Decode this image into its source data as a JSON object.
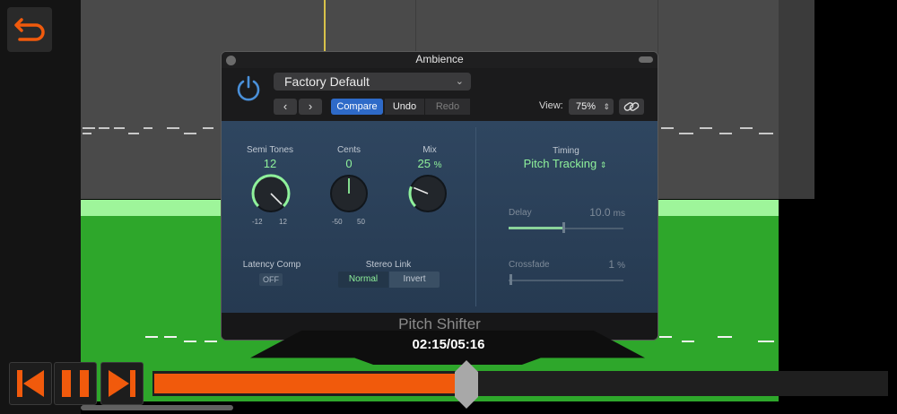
{
  "plugin": {
    "window_title": "Ambience",
    "preset": "Factory Default",
    "nav_prev": "‹",
    "nav_next": "›",
    "compare_label": "Compare",
    "undo_label": "Undo",
    "redo_label": "Redo",
    "view_label": "View:",
    "view_value": "75%",
    "plugin_name": "Pitch Shifter",
    "semi_tones": {
      "label": "Semi Tones",
      "value": "12",
      "min": "-12",
      "max": "12",
      "level": 1.0
    },
    "cents": {
      "label": "Cents",
      "value": "0",
      "min": "-50",
      "max": "50",
      "level": 0.5
    },
    "mix": {
      "label": "Mix",
      "value": "25",
      "unit": "%",
      "level": 0.25
    },
    "latency_comp": {
      "label": "Latency Comp",
      "value": "OFF"
    },
    "stereo_link": {
      "label": "Stereo Link",
      "options": [
        "Normal",
        "Invert"
      ],
      "selected": "Normal"
    },
    "timing": {
      "label": "Timing",
      "value": "Pitch Tracking"
    },
    "delay": {
      "label": "Delay",
      "value": "10.0",
      "unit": "ms",
      "level": 0.48
    },
    "crossfade": {
      "label": "Crossfade",
      "value": "1",
      "unit": "%",
      "level": 0.01
    }
  },
  "player": {
    "time": "02:15/05:16",
    "progress": 0.427
  },
  "colors": {
    "accent_orange": "#f15a0c",
    "value_green": "#8ff19b",
    "compare_blue": "#2e6ac8",
    "region_green": "#2ea72b",
    "power_blue": "#4a90d9"
  },
  "icons": {
    "back": "undo-arrow-icon",
    "power": "power-icon",
    "link": "link-icon",
    "skip_back": "skip-back-icon",
    "pause": "pause-icon",
    "skip_forward": "skip-forward-icon"
  }
}
